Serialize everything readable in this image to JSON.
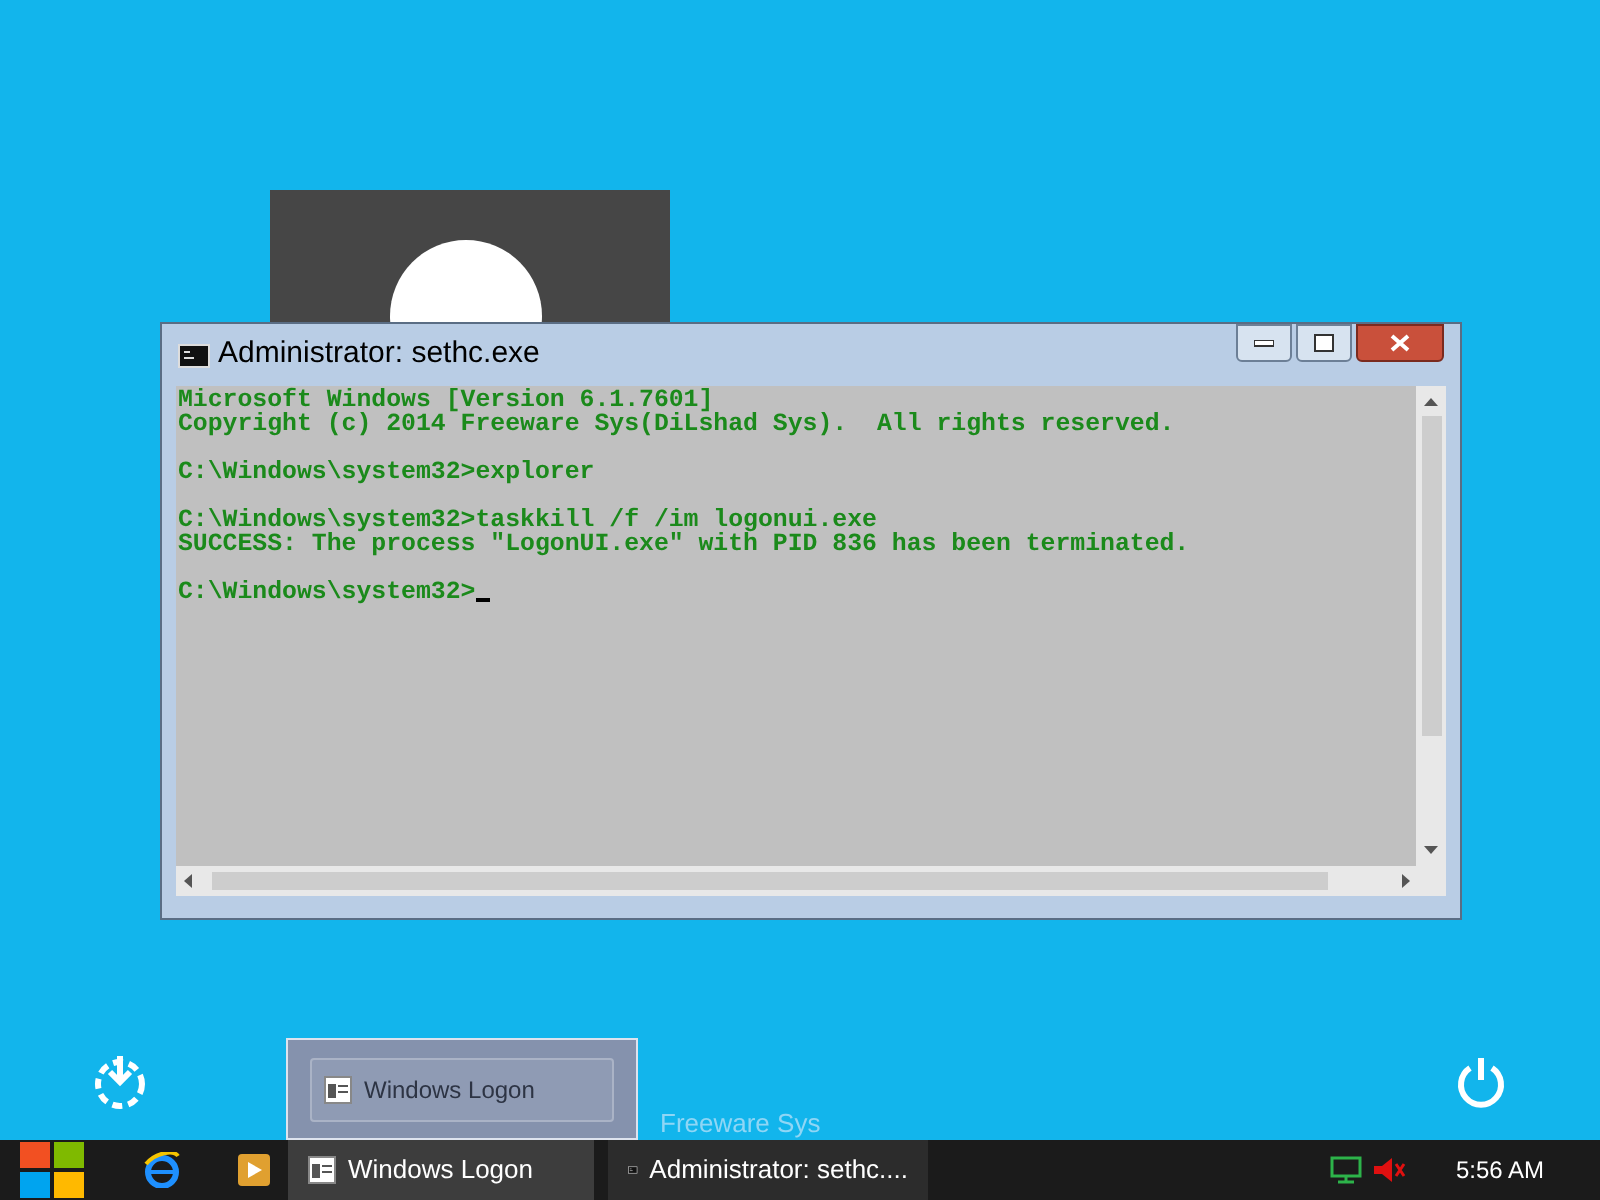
{
  "console_window": {
    "title": "Administrator: sethc.exe",
    "blocks": [
      [
        "Microsoft Windows [Version 6.1.7601]",
        "Copyright (c) 2014 Freeware Sys(DiLshad Sys).  All rights reserved."
      ],
      [
        "C:\\Windows\\system32>explorer"
      ],
      [
        "C:\\Windows\\system32>taskkill /f /im logonui.exe",
        "SUCCESS: The process \"LogonUI.exe\" with PID 836 has been terminated."
      ]
    ],
    "prompt": "C:\\Windows\\system32>"
  },
  "logon_screen": {
    "footer_text": "Freeware Sys"
  },
  "taskbar_preview": {
    "label": "Windows Logon"
  },
  "taskbar": {
    "buttons": [
      {
        "label": "Windows Logon",
        "selected": true,
        "kind": "window"
      },
      {
        "label": "Administrator: sethc....",
        "selected": false,
        "kind": "console"
      }
    ],
    "clock": "5:56 AM"
  }
}
